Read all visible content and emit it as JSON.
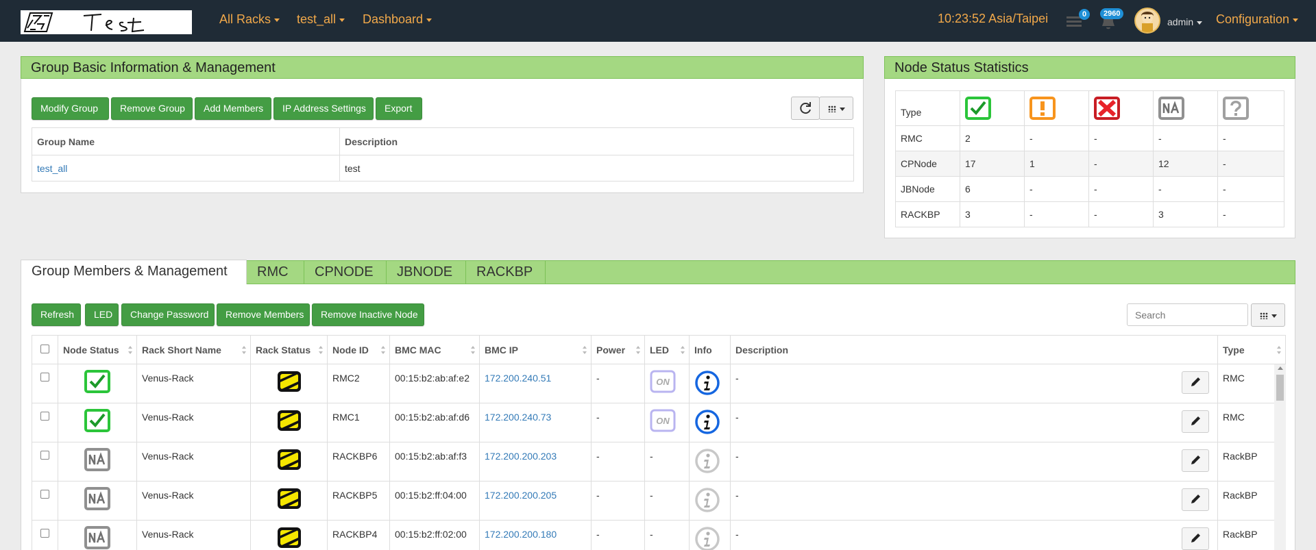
{
  "nav": {
    "menus": [
      "All Racks",
      "test_all",
      "Dashboard"
    ],
    "clock": "10:23:52 Asia/Taipei",
    "list_badge": "0",
    "bell_badge": "2960",
    "user": "admin",
    "config": "Configuration"
  },
  "group": {
    "title": "Group Basic Information & Management",
    "buttons": [
      "Modify Group",
      "Remove Group",
      "Add Members",
      "IP Address Settings",
      "Export"
    ],
    "headers": [
      "Group Name",
      "Description"
    ],
    "row": {
      "name": "test_all",
      "description": "test"
    }
  },
  "stats": {
    "title": "Node Status Statistics",
    "type_header": "Type",
    "rows": [
      {
        "type": "RMC",
        "vals": [
          "2",
          "-",
          "-",
          "-",
          "-"
        ]
      },
      {
        "type": "CPNode",
        "vals": [
          "17",
          "1",
          "-",
          "12",
          "-"
        ]
      },
      {
        "type": "JBNode",
        "vals": [
          "6",
          "-",
          "-",
          "-",
          "-"
        ]
      },
      {
        "type": "RACKBP",
        "vals": [
          "3",
          "-",
          "-",
          "3",
          "-"
        ]
      }
    ]
  },
  "tabs": [
    "Group Members & Management",
    "RMC",
    "CPNODE",
    "JBNODE",
    "RACKBP"
  ],
  "members": {
    "buttons": [
      "Refresh",
      "LED",
      "Change Password",
      "Remove Members",
      "Remove Inactive Node"
    ],
    "search_placeholder": "Search",
    "headers": [
      "Node Status",
      "Rack Short Name",
      "Rack Status",
      "Node ID",
      "BMC MAC",
      "BMC IP",
      "Power",
      "LED",
      "Info",
      "Description",
      "Type"
    ],
    "rows": [
      {
        "status": "ok",
        "rack": "Venus-Rack",
        "node": "RMC2",
        "mac": "00:15:b2:ab:af:e2",
        "ip": "172.200.240.51",
        "power": "-",
        "led": "on",
        "info": "active",
        "desc": "-",
        "type": "RMC"
      },
      {
        "status": "ok",
        "rack": "Venus-Rack",
        "node": "RMC1",
        "mac": "00:15:b2:ab:af:d6",
        "ip": "172.200.240.73",
        "power": "-",
        "led": "on",
        "info": "active",
        "desc": "-",
        "type": "RMC"
      },
      {
        "status": "na",
        "rack": "Venus-Rack",
        "node": "RACKBP6",
        "mac": "00:15:b2:ab:af:f3",
        "ip": "172.200.200.203",
        "power": "-",
        "led": "-",
        "info": "inactive",
        "desc": "-",
        "type": "RackBP"
      },
      {
        "status": "na",
        "rack": "Venus-Rack",
        "node": "RACKBP5",
        "mac": "00:15:b2:ff:04:00",
        "ip": "172.200.200.205",
        "power": "-",
        "led": "-",
        "info": "inactive",
        "desc": "-",
        "type": "RackBP"
      },
      {
        "status": "na",
        "rack": "Venus-Rack",
        "node": "RACKBP4",
        "mac": "00:15:b2:ff:02:00",
        "ip": "172.200.200.180",
        "power": "-",
        "led": "-",
        "info": "inactive",
        "desc": "-",
        "type": "RackBP"
      }
    ]
  },
  "colors": {
    "navbar": "#1f2b36",
    "accent": "#f2a94a",
    "panel_header": "#a4d882",
    "button": "#449d44",
    "link": "#337ab7",
    "ok": "#2bc53a",
    "warn": "#f7941d",
    "error": "#e8232a",
    "na": "#909090"
  }
}
